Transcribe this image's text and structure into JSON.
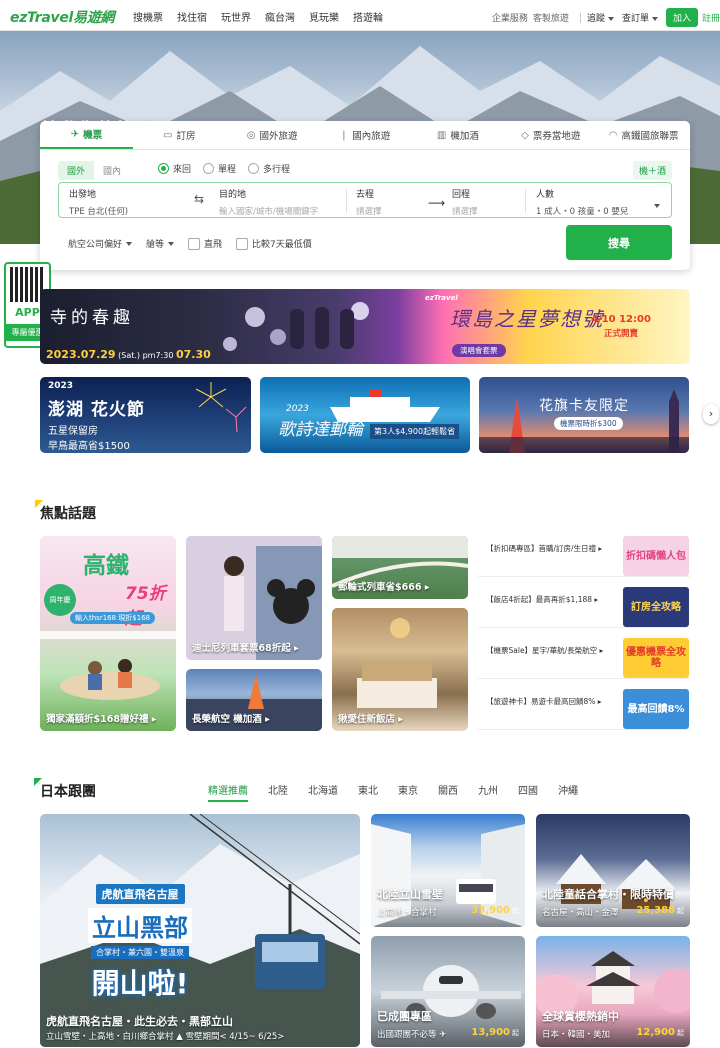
{
  "header": {
    "logo": "ezTravel易遊網",
    "nav": [
      "搜機票",
      "找住宿",
      "玩世界",
      "瘋台灣",
      "覓玩樂",
      "搭遊輪"
    ],
    "links": [
      "企業服務",
      "客製旅遊"
    ],
    "tracking": "追蹤",
    "orders": "查訂單",
    "join": "加入",
    "login": "註冊"
  },
  "hero": {
    "title": "啟動你的旅程"
  },
  "search": {
    "tabs": [
      {
        "label": "機票",
        "icon": "plane-icon",
        "active": true
      },
      {
        "label": "訂房",
        "icon": "bed-icon",
        "active": false
      },
      {
        "label": "國外旅遊",
        "icon": "globe-icon",
        "active": false
      },
      {
        "label": "國內旅遊",
        "icon": "leaf-icon",
        "active": false
      },
      {
        "label": "機加酒",
        "icon": "building-icon",
        "active": false
      },
      {
        "label": "票券當地遊",
        "icon": "ticket-icon",
        "active": false
      },
      {
        "label": "高鐵國旅聯票",
        "icon": "train-icon",
        "active": false
      }
    ],
    "segment": [
      "國外",
      "國內"
    ],
    "trip_types": [
      "來回",
      "單程",
      "多行程"
    ],
    "hotel_chip": "機＋酒",
    "origin_label": "出發地",
    "origin_value": "TPE 台北(任何)",
    "swap": "⇆",
    "dest_label": "目的地",
    "dest_placeholder": "輸入國家/城市/機場關鍵字",
    "depart_label": "去程",
    "depart_placeholder": "請選擇",
    "arrow": "⟶",
    "return_label": "回程",
    "return_placeholder": "請選擇",
    "pax_label": "人數",
    "pax_value": "1 成人・0 孩童・0 嬰兒",
    "airline_pref": "航空公司偏好",
    "cabin": "艙等",
    "direct": "直飛",
    "compare": "比較7天最低價",
    "search_btn": "搜尋"
  },
  "qr": {
    "title": "APP",
    "subtitle": "專屬優惠"
  },
  "banner_main": {
    "left_title": "寺的春趣",
    "date": "2023.07.29",
    "date_extra": "(Sat.) pm7:30",
    "time_big": "07.30",
    "logo": "ezTravel",
    "title": "環島之星夢想號",
    "badge": "演唱會套票",
    "open_time": "4/10 12:00",
    "open_label": "正式開賣"
  },
  "banners": [
    {
      "year": "2023",
      "title": "澎湖 花火節",
      "line1": "五星保留房",
      "line2": "早鳥最高省$1500"
    },
    {
      "year": "2023",
      "title": "歌詩達郵輪",
      "line1": "第3人$4,900起輕鬆省"
    },
    {
      "title": "花旗卡友限定",
      "line1": "機票限時折$300"
    }
  ],
  "focus": {
    "title": "焦點話題",
    "cards": [
      {
        "caption": "獨家滿額折$168贈好禮 ▸",
        "head": "高鐵",
        "num": "75折起",
        "sub": "輸入thsr168 現折$168",
        "badge": "周年慶"
      },
      {
        "caption": "迪士尼列車套票68折起 ▸"
      },
      {
        "caption": "長榮航空 機加酒 ▸"
      },
      {
        "caption": "郵輪式列車省$666 ▸"
      },
      {
        "caption": "揪愛住新飯店 ▸"
      }
    ],
    "list": [
      {
        "text": "【折扣碼專區】首購/訂房/生日禮 ▸",
        "thumb": "折扣碼懶人包"
      },
      {
        "text": "【飯店4折起】最高再折$1,188 ▸",
        "thumb": "訂房全攻略"
      },
      {
        "text": "【機票Sale】星宇/華航/長榮航空 ▸",
        "thumb": "優惠機票全攻略"
      },
      {
        "text": "【旅遊神卡】易遊卡最高回饋8% ▸",
        "thumb": "最高回饋8%"
      }
    ]
  },
  "japan": {
    "title": "日本跟團",
    "tabs": [
      "精選推薦",
      "北陸",
      "北海道",
      "東北",
      "東京",
      "關西",
      "九州",
      "四國",
      "沖繩"
    ],
    "big": {
      "tag": "虎航直飛名古屋",
      "name": "立山黑部",
      "sub": "合掌村・兼六園・雙溫泉",
      "big": "開山啦!",
      "title": "虎航直飛名古屋・此生必去・黑部立山",
      "desc": "立山雪壁・上高地・白川鄉合掌村 ▲ 雪壁期間< 4/15~ 6/25>"
    },
    "tours": [
      {
        "title": "北陸立山雪壁",
        "desc": "上高地・合掌村",
        "price": "33,900",
        "unit": "起"
      },
      {
        "title": "北陸童話合掌村・限時特價",
        "desc": "名古屋・高山・金澤",
        "price": "25,388",
        "unit": "起"
      },
      {
        "title": "已成團專區",
        "desc": "出國跟團不必等 ✈",
        "price": "13,900",
        "unit": "起"
      },
      {
        "title": "全球賞櫻熱銷中",
        "desc": "日本・韓國・美加",
        "price": "12,900",
        "unit": "起"
      }
    ]
  }
}
